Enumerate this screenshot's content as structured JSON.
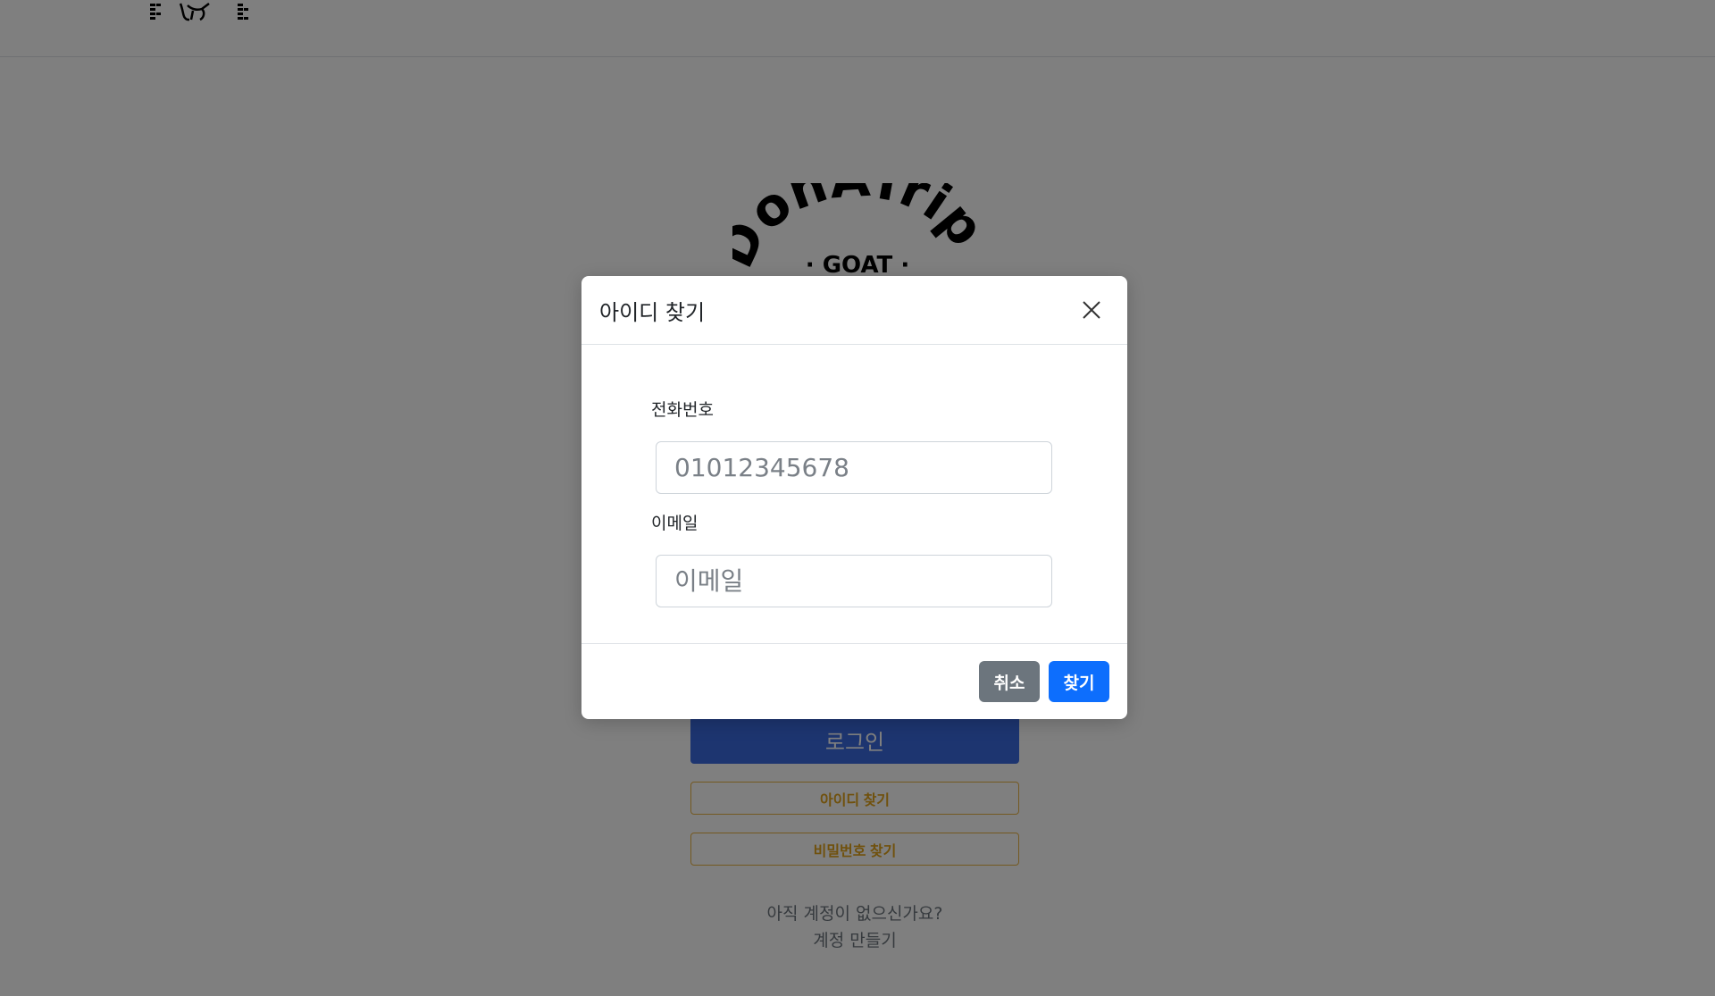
{
  "header": {
    "logo_icon": "goat-icon"
  },
  "login": {
    "brand_logo_text": "DonATrip",
    "brand_logo_sub": "· GOAT ·",
    "login_button": "로그인",
    "find_id_button": "아이디 찾기",
    "find_pw_button": "비밀번호 찾기",
    "signup_prompt": "아직 계정이 없으신가요?",
    "signup_link": "계정 만들기"
  },
  "modal": {
    "title": "아이디 찾기",
    "close_icon": "close-icon",
    "phone_label": "전화번호",
    "phone_placeholder": "01012345678",
    "email_label": "이메일",
    "email_placeholder": "이메일",
    "cancel_button": "취소",
    "find_button": "찾기"
  },
  "colors": {
    "primary": "#0d6efd",
    "secondary": "#6c757d",
    "warning_outline": "#e0a21b",
    "backdrop": "rgba(0,0,0,0.5)"
  }
}
